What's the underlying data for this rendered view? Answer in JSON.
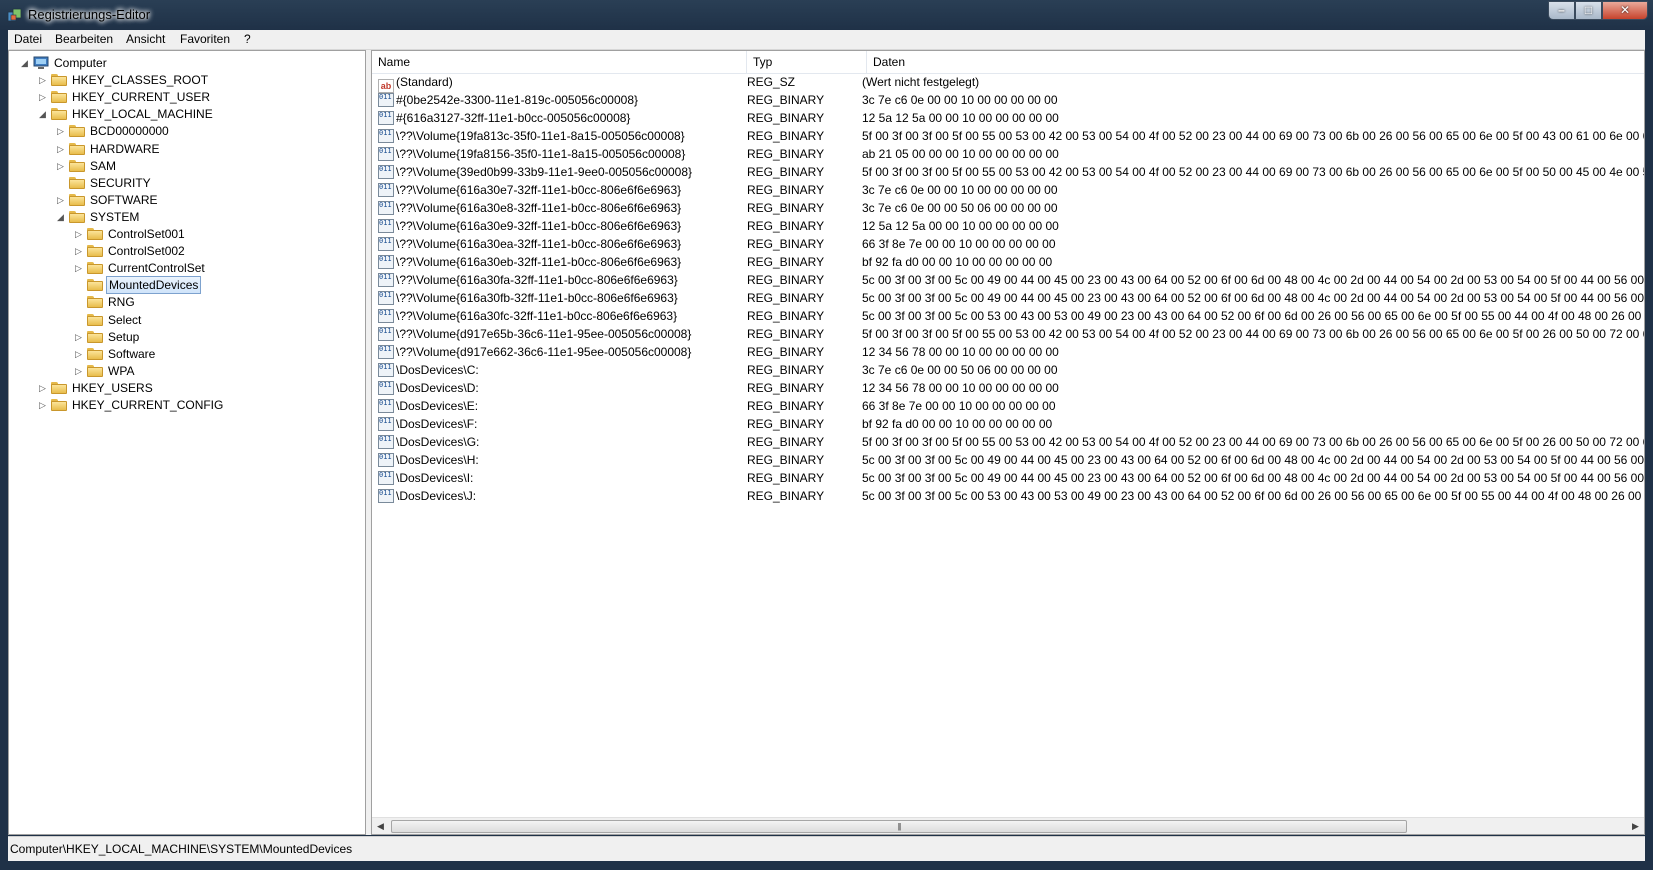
{
  "window": {
    "title": "Registrierungs-Editor"
  },
  "menu": [
    "Datei",
    "Bearbeiten",
    "Ansicht",
    "Favoriten",
    "?"
  ],
  "tree": [
    {
      "label": "Computer",
      "level": 0,
      "expander": "expanded",
      "icon": "computer-icon"
    },
    {
      "label": "HKEY_CLASSES_ROOT",
      "level": 1,
      "expander": "collapsed"
    },
    {
      "label": "HKEY_CURRENT_USER",
      "level": 1,
      "expander": "collapsed"
    },
    {
      "label": "HKEY_LOCAL_MACHINE",
      "level": 1,
      "expander": "expanded"
    },
    {
      "label": "BCD00000000",
      "level": 2,
      "expander": "collapsed"
    },
    {
      "label": "HARDWARE",
      "level": 2,
      "expander": "collapsed"
    },
    {
      "label": "SAM",
      "level": 2,
      "expander": "collapsed"
    },
    {
      "label": "SECURITY",
      "level": 2,
      "expander": "none"
    },
    {
      "label": "SOFTWARE",
      "level": 2,
      "expander": "collapsed"
    },
    {
      "label": "SYSTEM",
      "level": 2,
      "expander": "expanded"
    },
    {
      "label": "ControlSet001",
      "level": 3,
      "expander": "collapsed"
    },
    {
      "label": "ControlSet002",
      "level": 3,
      "expander": "collapsed"
    },
    {
      "label": "CurrentControlSet",
      "level": 3,
      "expander": "collapsed"
    },
    {
      "label": "MountedDevices",
      "level": 3,
      "expander": "none",
      "selected": true
    },
    {
      "label": "RNG",
      "level": 3,
      "expander": "none"
    },
    {
      "label": "Select",
      "level": 3,
      "expander": "none"
    },
    {
      "label": "Setup",
      "level": 3,
      "expander": "collapsed"
    },
    {
      "label": "Software",
      "level": 3,
      "expander": "collapsed"
    },
    {
      "label": "WPA",
      "level": 3,
      "expander": "collapsed"
    },
    {
      "label": "HKEY_USERS",
      "level": 1,
      "expander": "collapsed"
    },
    {
      "label": "HKEY_CURRENT_CONFIG",
      "level": 1,
      "expander": "collapsed"
    }
  ],
  "columns": {
    "name": "Name",
    "type": "Typ",
    "data": "Daten"
  },
  "values": [
    {
      "name": "(Standard)",
      "type": "REG_SZ",
      "data": "(Wert nicht festgelegt)",
      "icon": "string-value-icon"
    },
    {
      "name": "#{0be2542e-3300-11e1-819c-005056c00008}",
      "type": "REG_BINARY",
      "data": "3c 7e c6 0e 00 00 10 00 00 00 00 00",
      "icon": "binary-value-icon"
    },
    {
      "name": "#{616a3127-32ff-11e1-b0cc-005056c00008}",
      "type": "REG_BINARY",
      "data": "12 5a 12 5a 00 00 10 00 00 00 00 00",
      "icon": "binary-value-icon"
    },
    {
      "name": "\\??\\Volume{19fa813c-35f0-11e1-8a15-005056c00008}",
      "type": "REG_BINARY",
      "data": "5f 00 3f 00 3f 00 5f 00 55 00 53 00 42 00 53 00 54 00 4f 00 52 00 23 00 44 00 69 00 73 00 6b 00 26 00 56 00 65 00 6e 00 5f 00 43 00 61 00 6e 00 6f 00 6e 00 2",
      "icon": "binary-value-icon"
    },
    {
      "name": "\\??\\Volume{19fa8156-35f0-11e1-8a15-005056c00008}",
      "type": "REG_BINARY",
      "data": "ab 21 05 00 00 00 10 00 00 00 00 00",
      "icon": "binary-value-icon"
    },
    {
      "name": "\\??\\Volume{39ed0b99-33b9-11e1-9ee0-005056c00008}",
      "type": "REG_BINARY",
      "data": "5f 00 3f 00 3f 00 5f 00 55 00 53 00 42 00 53 00 54 00 4f 00 52 00 23 00 44 00 69 00 73 00 6b 00 26 00 56 00 65 00 6e 00 5f 00 50 00 45 00 4e 00 54 00 41 00 :",
      "icon": "binary-value-icon"
    },
    {
      "name": "\\??\\Volume{616a30e7-32ff-11e1-b0cc-806e6f6e6963}",
      "type": "REG_BINARY",
      "data": "3c 7e c6 0e 00 00 10 00 00 00 00 00",
      "icon": "binary-value-icon"
    },
    {
      "name": "\\??\\Volume{616a30e8-32ff-11e1-b0cc-806e6f6e6963}",
      "type": "REG_BINARY",
      "data": "3c 7e c6 0e 00 00 50 06 00 00 00 00",
      "icon": "binary-value-icon"
    },
    {
      "name": "\\??\\Volume{616a30e9-32ff-11e1-b0cc-806e6f6e6963}",
      "type": "REG_BINARY",
      "data": "12 5a 12 5a 00 00 10 00 00 00 00 00",
      "icon": "binary-value-icon"
    },
    {
      "name": "\\??\\Volume{616a30ea-32ff-11e1-b0cc-806e6f6e6963}",
      "type": "REG_BINARY",
      "data": "66 3f 8e 7e 00 00 10 00 00 00 00 00",
      "icon": "binary-value-icon"
    },
    {
      "name": "\\??\\Volume{616a30eb-32ff-11e1-b0cc-806e6f6e6963}",
      "type": "REG_BINARY",
      "data": "bf 92 fa d0 00 00 10 00 00 00 00 00",
      "icon": "binary-value-icon"
    },
    {
      "name": "\\??\\Volume{616a30fa-32ff-11e1-b0cc-806e6f6e6963}",
      "type": "REG_BINARY",
      "data": "5c 00 3f 00 3f 00 5c 00 49 00 44 00 45 00 23 00 43 00 64 00 52 00 6f 00 6d 00 48 00 4c 00 2d 00 44 00 54 00 2d 00 53 00 54 00 5f 00 44 00 56 00 44 00 52 00",
      "icon": "binary-value-icon"
    },
    {
      "name": "\\??\\Volume{616a30fb-32ff-11e1-b0cc-806e6f6e6963}",
      "type": "REG_BINARY",
      "data": "5c 00 3f 00 3f 00 5c 00 49 00 44 00 45 00 23 00 43 00 64 00 52 00 6f 00 6d 00 48 00 4c 00 2d 00 44 00 54 00 2d 00 53 00 54 00 5f 00 44 00 56 00 44 00 52 00",
      "icon": "binary-value-icon"
    },
    {
      "name": "\\??\\Volume{616a30fc-32ff-11e1-b0cc-806e6f6e6963}",
      "type": "REG_BINARY",
      "data": "5c 00 3f 00 3f 00 5c 00 53 00 43 00 53 00 49 00 23 00 43 00 64 00 52 00 6f 00 6d 00 26 00 56 00 65 00 6e 00 5f 00 55 00 44 00 4f 00 48 00 26 00 50 00 72 00",
      "icon": "binary-value-icon"
    },
    {
      "name": "\\??\\Volume{d917e65b-36c6-11e1-95ee-005056c00008}",
      "type": "REG_BINARY",
      "data": "5f 00 3f 00 3f 00 5f 00 55 00 53 00 42 00 53 00 54 00 4f 00 52 00 23 00 44 00 69 00 73 00 6b 00 26 00 56 00 65 00 6e 00 5f 00 26 00 50 00 72 00 6f 00 64 00 5",
      "icon": "binary-value-icon"
    },
    {
      "name": "\\??\\Volume{d917e662-36c6-11e1-95ee-005056c00008}",
      "type": "REG_BINARY",
      "data": "12 34 56 78 00 00 10 00 00 00 00 00",
      "icon": "binary-value-icon"
    },
    {
      "name": "\\DosDevices\\C:",
      "type": "REG_BINARY",
      "data": "3c 7e c6 0e 00 00 50 06 00 00 00 00",
      "icon": "binary-value-icon"
    },
    {
      "name": "\\DosDevices\\D:",
      "type": "REG_BINARY",
      "data": "12 34 56 78 00 00 10 00 00 00 00 00",
      "icon": "binary-value-icon"
    },
    {
      "name": "\\DosDevices\\E:",
      "type": "REG_BINARY",
      "data": "66 3f 8e 7e 00 00 10 00 00 00 00 00",
      "icon": "binary-value-icon"
    },
    {
      "name": "\\DosDevices\\F:",
      "type": "REG_BINARY",
      "data": "bf 92 fa d0 00 00 10 00 00 00 00 00",
      "icon": "binary-value-icon"
    },
    {
      "name": "\\DosDevices\\G:",
      "type": "REG_BINARY",
      "data": "5f 00 3f 00 3f 00 5f 00 55 00 53 00 42 00 53 00 54 00 4f 00 52 00 23 00 44 00 69 00 73 00 6b 00 26 00 56 00 65 00 6e 00 5f 00 26 00 50 00 72 00 6f 00 64 00 5",
      "icon": "binary-value-icon"
    },
    {
      "name": "\\DosDevices\\H:",
      "type": "REG_BINARY",
      "data": "5c 00 3f 00 3f 00 5c 00 49 00 44 00 45 00 23 00 43 00 64 00 52 00 6f 00 6d 00 48 00 4c 00 2d 00 44 00 54 00 2d 00 53 00 54 00 5f 00 44 00 56 00 44 00 52 00",
      "icon": "binary-value-icon"
    },
    {
      "name": "\\DosDevices\\I:",
      "type": "REG_BINARY",
      "data": "5c 00 3f 00 3f 00 5c 00 49 00 44 00 45 00 23 00 43 00 64 00 52 00 6f 00 6d 00 48 00 4c 00 2d 00 44 00 54 00 2d 00 53 00 54 00 5f 00 44 00 56 00 44 00 52 00",
      "icon": "binary-value-icon"
    },
    {
      "name": "\\DosDevices\\J:",
      "type": "REG_BINARY",
      "data": "5c 00 3f 00 3f 00 5c 00 53 00 43 00 53 00 49 00 23 00 43 00 64 00 52 00 6f 00 6d 00 26 00 56 00 65 00 6e 00 5f 00 55 00 44 00 4f 00 48 00 26 00 50 00 72 00",
      "icon": "binary-value-icon"
    }
  ],
  "statusbar": {
    "path": "Computer\\HKEY_LOCAL_MACHINE\\SYSTEM\\MountedDevices"
  }
}
